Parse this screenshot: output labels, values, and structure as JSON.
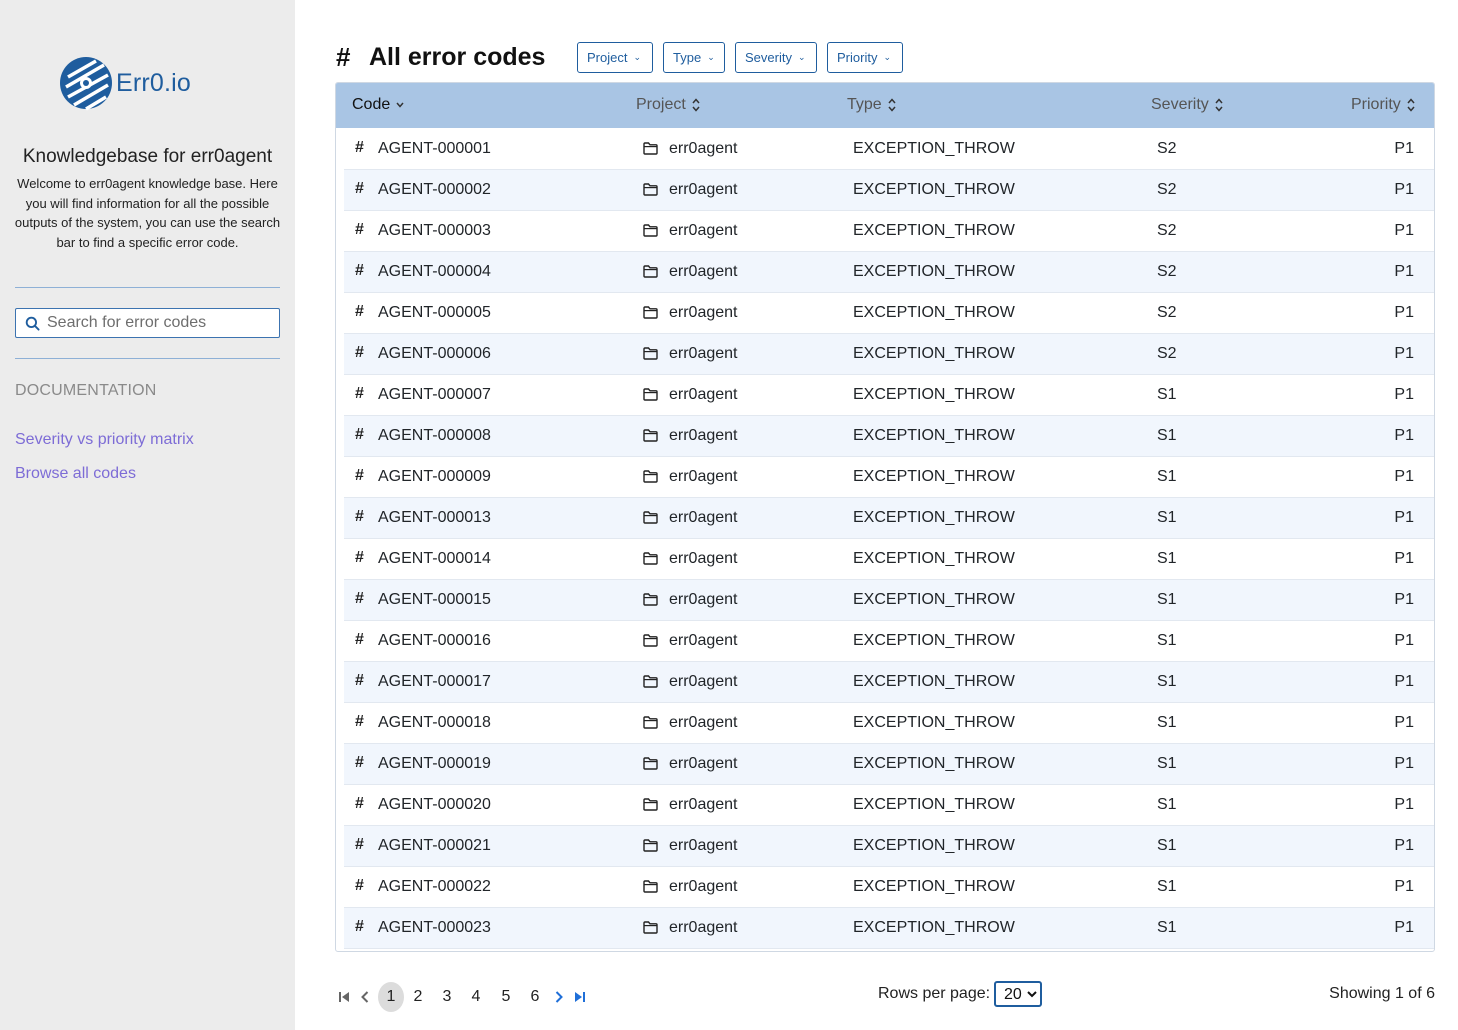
{
  "app": {
    "logo_text": "Err0.io"
  },
  "sidebar": {
    "title": "Knowledgebase for err0agent",
    "description": "Welcome to err0agent knowledge base. Here you will find information for all the possible outputs of the system, you can use the search bar to find a specific error code.",
    "search_placeholder": "Search for error codes",
    "section_heading": "DOCUMENTATION",
    "links": [
      {
        "label": "Severity vs priority matrix"
      },
      {
        "label": "Browse all codes"
      }
    ]
  },
  "header": {
    "title": "All error codes",
    "filters": [
      "Project",
      "Type",
      "Severity",
      "Priority"
    ]
  },
  "table": {
    "columns": [
      "Code",
      "Project",
      "Type",
      "Severity",
      "Priority"
    ],
    "rows": [
      {
        "code": "AGENT-000001",
        "project": "err0agent",
        "type": "EXCEPTION_THROW",
        "severity": "S2",
        "priority": "P1"
      },
      {
        "code": "AGENT-000002",
        "project": "err0agent",
        "type": "EXCEPTION_THROW",
        "severity": "S2",
        "priority": "P1"
      },
      {
        "code": "AGENT-000003",
        "project": "err0agent",
        "type": "EXCEPTION_THROW",
        "severity": "S2",
        "priority": "P1"
      },
      {
        "code": "AGENT-000004",
        "project": "err0agent",
        "type": "EXCEPTION_THROW",
        "severity": "S2",
        "priority": "P1"
      },
      {
        "code": "AGENT-000005",
        "project": "err0agent",
        "type": "EXCEPTION_THROW",
        "severity": "S2",
        "priority": "P1"
      },
      {
        "code": "AGENT-000006",
        "project": "err0agent",
        "type": "EXCEPTION_THROW",
        "severity": "S2",
        "priority": "P1"
      },
      {
        "code": "AGENT-000007",
        "project": "err0agent",
        "type": "EXCEPTION_THROW",
        "severity": "S1",
        "priority": "P1"
      },
      {
        "code": "AGENT-000008",
        "project": "err0agent",
        "type": "EXCEPTION_THROW",
        "severity": "S1",
        "priority": "P1"
      },
      {
        "code": "AGENT-000009",
        "project": "err0agent",
        "type": "EXCEPTION_THROW",
        "severity": "S1",
        "priority": "P1"
      },
      {
        "code": "AGENT-000013",
        "project": "err0agent",
        "type": "EXCEPTION_THROW",
        "severity": "S1",
        "priority": "P1"
      },
      {
        "code": "AGENT-000014",
        "project": "err0agent",
        "type": "EXCEPTION_THROW",
        "severity": "S1",
        "priority": "P1"
      },
      {
        "code": "AGENT-000015",
        "project": "err0agent",
        "type": "EXCEPTION_THROW",
        "severity": "S1",
        "priority": "P1"
      },
      {
        "code": "AGENT-000016",
        "project": "err0agent",
        "type": "EXCEPTION_THROW",
        "severity": "S1",
        "priority": "P1"
      },
      {
        "code": "AGENT-000017",
        "project": "err0agent",
        "type": "EXCEPTION_THROW",
        "severity": "S1",
        "priority": "P1"
      },
      {
        "code": "AGENT-000018",
        "project": "err0agent",
        "type": "EXCEPTION_THROW",
        "severity": "S1",
        "priority": "P1"
      },
      {
        "code": "AGENT-000019",
        "project": "err0agent",
        "type": "EXCEPTION_THROW",
        "severity": "S1",
        "priority": "P1"
      },
      {
        "code": "AGENT-000020",
        "project": "err0agent",
        "type": "EXCEPTION_THROW",
        "severity": "S1",
        "priority": "P1"
      },
      {
        "code": "AGENT-000021",
        "project": "err0agent",
        "type": "EXCEPTION_THROW",
        "severity": "S1",
        "priority": "P1"
      },
      {
        "code": "AGENT-000022",
        "project": "err0agent",
        "type": "EXCEPTION_THROW",
        "severity": "S1",
        "priority": "P1"
      },
      {
        "code": "AGENT-000023",
        "project": "err0agent",
        "type": "EXCEPTION_THROW",
        "severity": "S1",
        "priority": "P1"
      }
    ]
  },
  "pagination": {
    "pages": [
      "1",
      "2",
      "3",
      "4",
      "5",
      "6"
    ],
    "current_page": "1",
    "rows_per_page_label": "Rows per page:",
    "rows_per_page_value": "20",
    "showing_text": "Showing 1 of 6"
  },
  "colors": {
    "accent": "#1f5d9e",
    "header_bg": "#a9c5e4",
    "sidebar_bg": "#ececec",
    "link": "#7d6cd6",
    "row_alt": "#f1f6fd"
  },
  "icons": {
    "logo": "err0-logo-icon",
    "search": "search-icon",
    "hash": "hash-icon",
    "folder": "folder-icon",
    "sort": "sort-icon",
    "chevron": "chevron-down-icon",
    "first": "first-page-icon",
    "prev": "prev-page-icon",
    "next": "next-page-icon",
    "last": "last-page-icon"
  }
}
